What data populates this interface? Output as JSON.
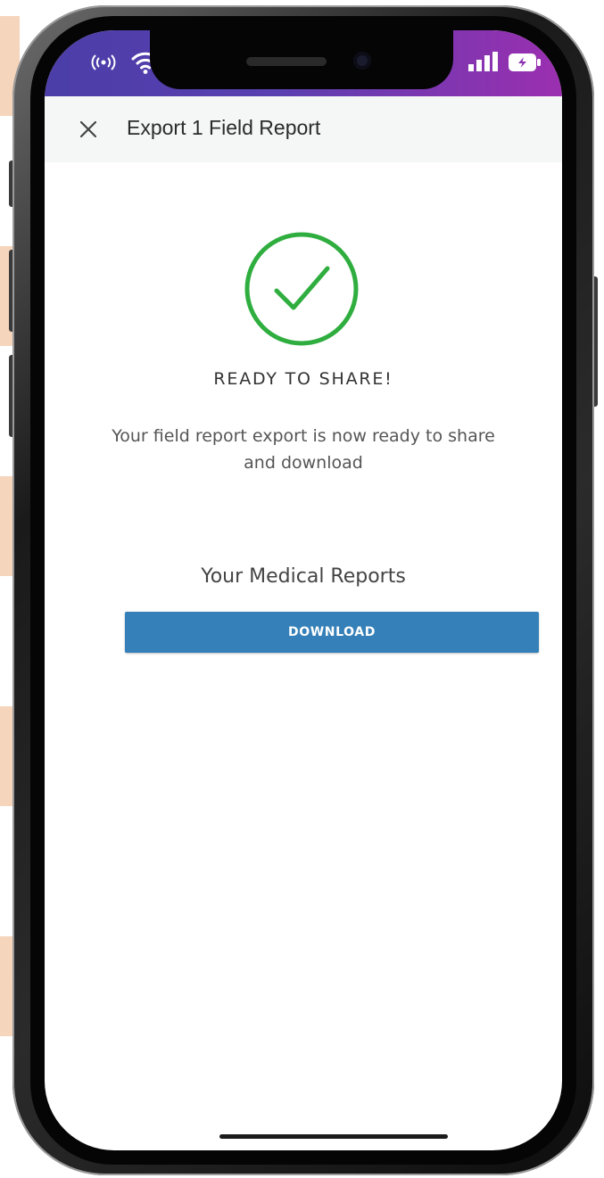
{
  "header": {
    "title": "Export 1 Field Report"
  },
  "status": {
    "title": "READY TO SHARE!",
    "message": "Your field report export is now ready to share and download"
  },
  "reports": {
    "label": "Your Medical Reports",
    "download_label": "DOWNLOAD"
  },
  "colors": {
    "status_bar_start": "#4b3ea8",
    "status_bar_end": "#9b2fb0",
    "success_green": "#2fae3f",
    "button_blue": "#3580b8"
  },
  "icons": {
    "close": "close-icon",
    "success": "check-circle-icon",
    "hotspot": "hotspot-icon",
    "wifi": "wifi-icon",
    "signal": "signal-icon",
    "battery": "battery-icon"
  }
}
